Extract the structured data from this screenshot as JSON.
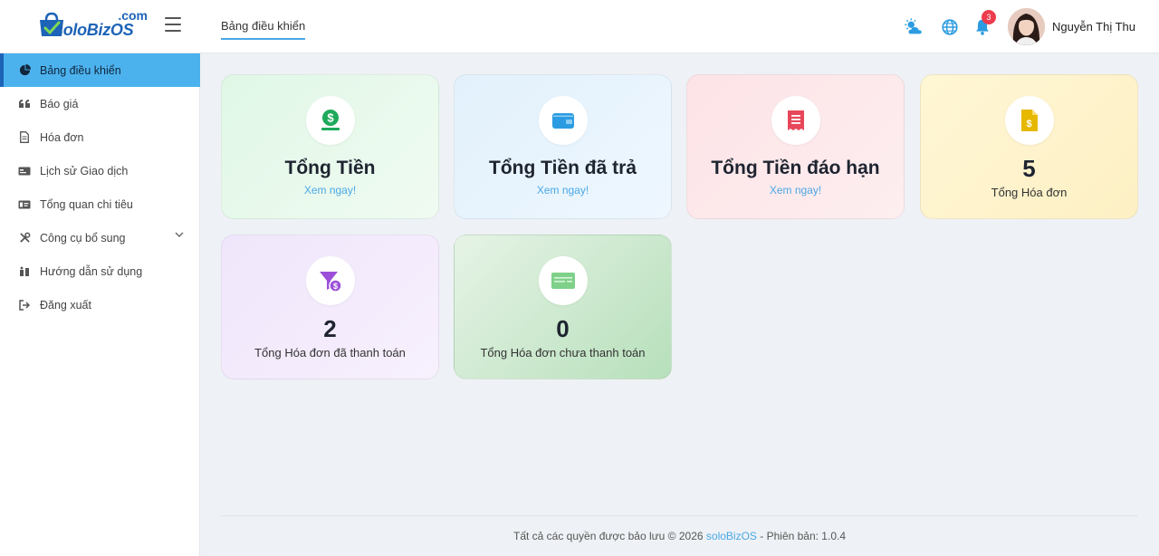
{
  "header": {
    "logo_main": "soloBizOS",
    "logo_com": ".com",
    "active_tab": "Bảng điều khiển",
    "notification_count": "3",
    "user_name": "Nguyễn Thị Thu",
    "icons": [
      "weather-icon",
      "globe-icon",
      "bell-icon"
    ]
  },
  "sidebar": {
    "items": [
      {
        "label": "Bảng điều khiển",
        "icon": "pie-chart-icon",
        "active": true
      },
      {
        "label": "Báo giá",
        "icon": "quote-icon"
      },
      {
        "label": "Hóa đơn",
        "icon": "document-icon"
      },
      {
        "label": "Lịch sử Giao dịch",
        "icon": "card-icon"
      },
      {
        "label": "Tổng quan chi tiêu",
        "icon": "id-card-icon"
      },
      {
        "label": "Công cụ bổ sung",
        "icon": "tools-icon",
        "has_submenu": true
      },
      {
        "label": "Hướng dẫn sử dụng",
        "icon": "guide-icon"
      },
      {
        "label": "Đăng xuất",
        "icon": "logout-icon"
      }
    ]
  },
  "cards": [
    {
      "title": "Tổng Tiền",
      "link": "Xem ngay!",
      "icon": "money-icon",
      "icon_color": "#1eaa5b"
    },
    {
      "title": "Tổng Tiền đã trả",
      "link": "Xem ngay!",
      "icon": "wallet-icon",
      "icon_color": "#2c9ce2"
    },
    {
      "title": "Tổng Tiền đáo hạn",
      "link": "Xem ngay!",
      "icon": "receipt-icon",
      "icon_color": "#e8465a"
    },
    {
      "value": "5",
      "label": "Tổng Hóa đơn",
      "icon": "invoice-icon",
      "icon_color": "#e6b800"
    },
    {
      "value": "2",
      "label": "Tổng Hóa đơn đã thanh toán",
      "icon": "funnel-dollar-icon",
      "icon_color": "#9b4fd9"
    },
    {
      "value": "0",
      "label": "Tổng Hóa đơn chưa thanh toán",
      "icon": "check-icon",
      "icon_color": "#7fd18a"
    }
  ],
  "footer": {
    "prefix": "Tất cả các quyền được bảo lưu © 2026",
    "brand": "soloBizOS",
    "suffix": "- Phiên bản: 1.0.4"
  },
  "colors": {
    "accent": "#4cb2ee",
    "brand": "#1d63b8",
    "link": "#4aa8e6",
    "badge": "#ec3c4d"
  }
}
